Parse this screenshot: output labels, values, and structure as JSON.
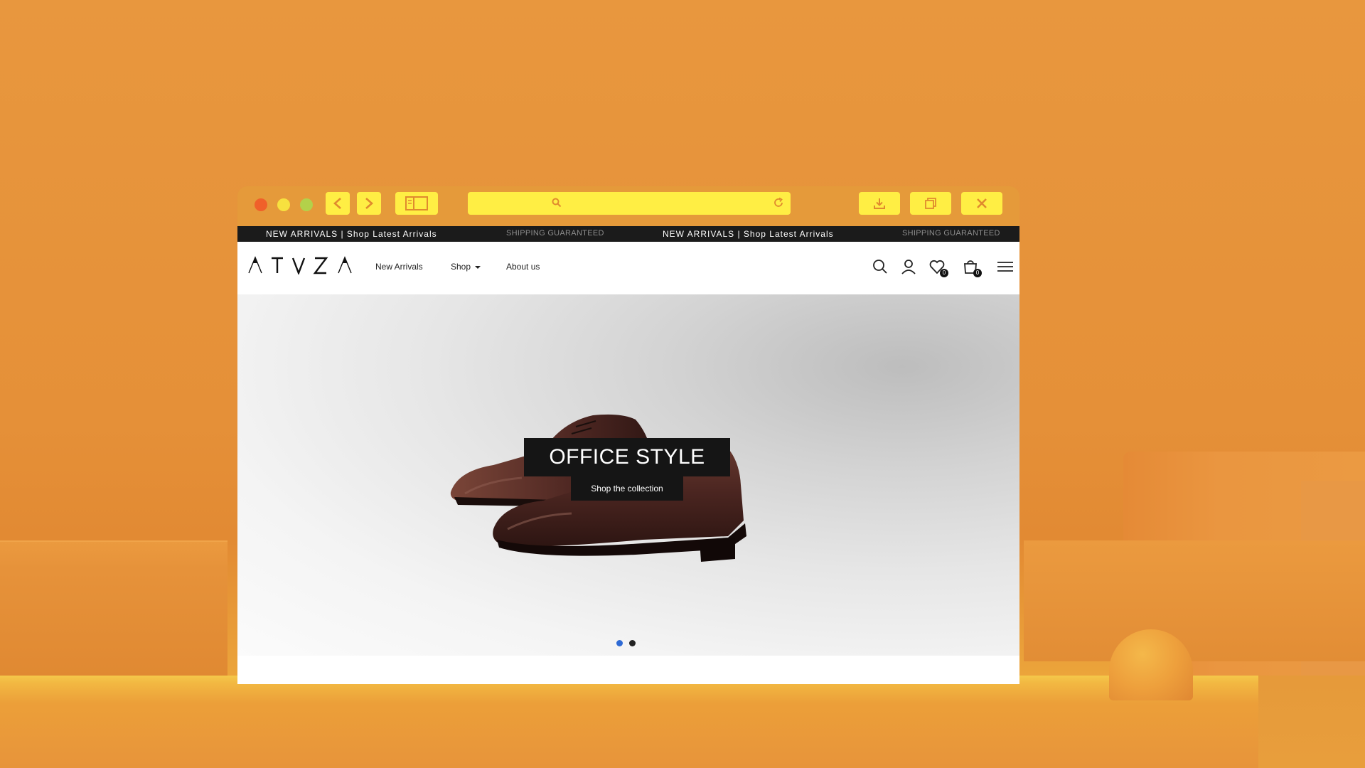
{
  "browser": {
    "chrome_color": "#e59a3a",
    "button_color": "#ffee44",
    "traffic_lights": [
      "#f0602a",
      "#f7e13f",
      "#b3d14a"
    ],
    "toolbar": {
      "back_icon": "chevron-left-icon",
      "forward_icon": "chevron-right-icon",
      "sidebar_icon": "sidebar-icon",
      "search_icon": "search-icon",
      "reload_icon": "reload-icon",
      "download_icon": "download-icon",
      "tabs_icon": "tabs-icon",
      "close_icon": "close-icon"
    }
  },
  "ticker": {
    "items": [
      "NEW ARRIVALS | Shop Latest Arrivals",
      "SHIPPING GUARANTEED",
      "NEW ARRIVALS | Shop Latest Arrivals",
      "SHIPPING GUARANTEED"
    ]
  },
  "header": {
    "logo": "ATVZA",
    "nav": [
      "New Arrivals",
      "Shop",
      "About us"
    ],
    "wishlist_count": "0",
    "cart_count": "0"
  },
  "hero": {
    "title": "OFFICE STYLE",
    "cta": "Shop the collection",
    "slides": 2,
    "active_slide": 1,
    "active_dot_color": "#2e6ad4"
  }
}
